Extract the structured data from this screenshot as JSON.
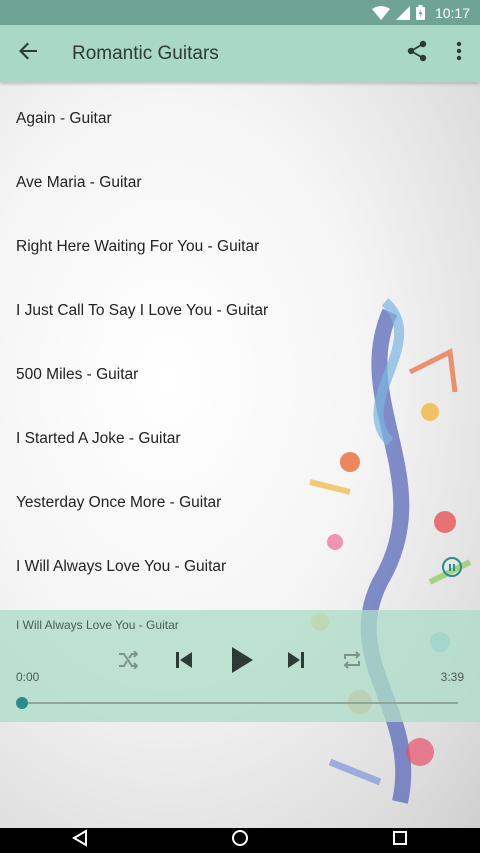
{
  "status_bar": {
    "time": "10:17",
    "icons": [
      "wifi-icon",
      "cell-signal-icon",
      "battery-icon"
    ]
  },
  "app_bar": {
    "title": "Romantic Guitars",
    "icons": [
      "arrow-back-icon",
      "share-icon",
      "more-vert-icon"
    ],
    "color": "#a9d9c4"
  },
  "songs": [
    {
      "title": "Again - Guitar"
    },
    {
      "title": "Ave Maria - Guitar"
    },
    {
      "title": "Right Here Waiting For You - Guitar"
    },
    {
      "title": "I Just Call To Say I Love You - Guitar"
    },
    {
      "title": "500 Miles - Guitar"
    },
    {
      "title": "I Started A Joke - Guitar"
    },
    {
      "title": "Yesterday Once More - Guitar"
    },
    {
      "title": "I Will Always Love You - Guitar"
    }
  ],
  "player": {
    "now_playing": "I Will Always Love You - Guitar",
    "current_time": "0:00",
    "total_time": "3:39",
    "progress": 0,
    "controls": [
      "shuffle-icon",
      "skip-previous-icon",
      "play-icon",
      "skip-next-icon",
      "repeat-icon"
    ],
    "accent": "#2a8d8a"
  },
  "nav_bar": {
    "icons": [
      "back-triangle-icon",
      "home-circle-icon",
      "recents-square-icon"
    ]
  }
}
